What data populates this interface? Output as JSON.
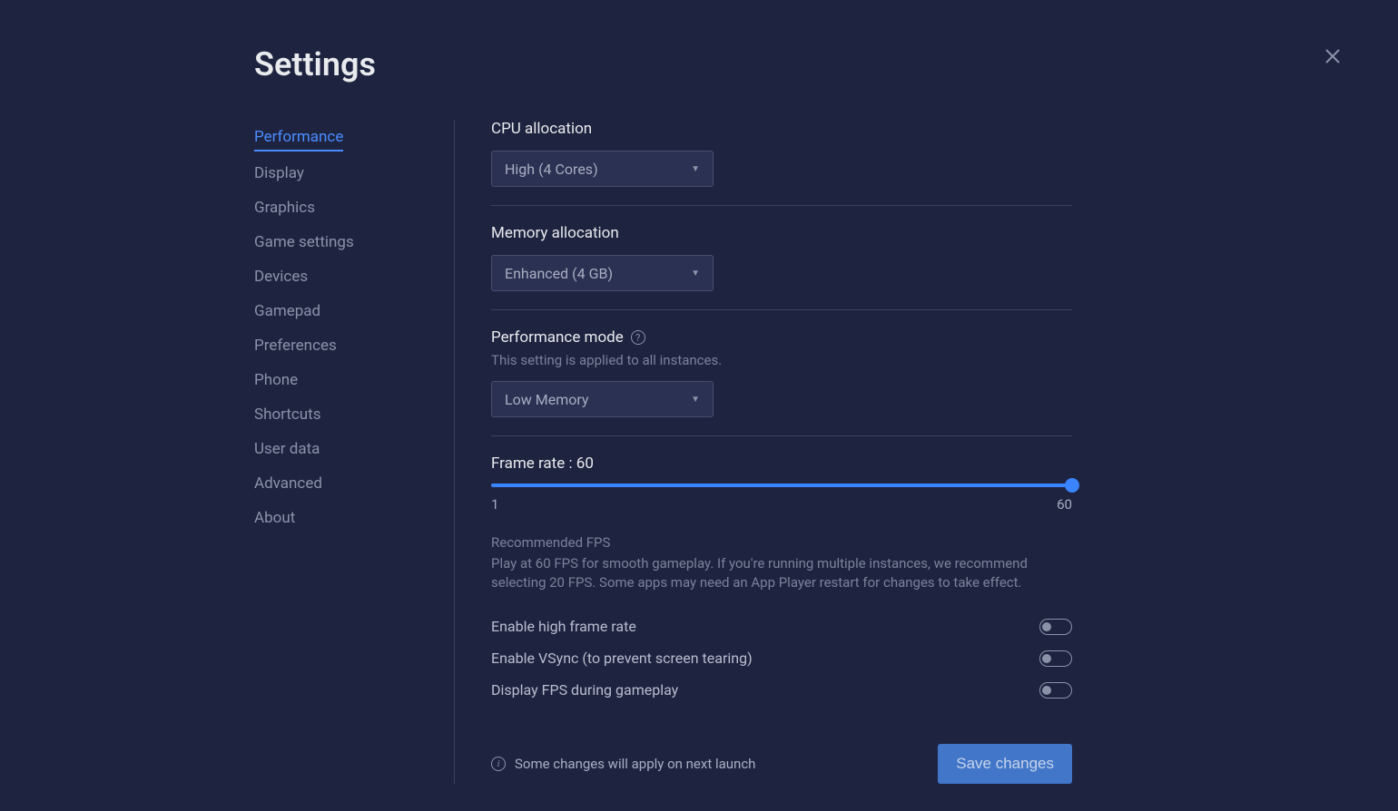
{
  "title": "Settings",
  "sidebar": {
    "items": [
      {
        "label": "Performance",
        "active": true
      },
      {
        "label": "Display",
        "active": false
      },
      {
        "label": "Graphics",
        "active": false
      },
      {
        "label": "Game settings",
        "active": false
      },
      {
        "label": "Devices",
        "active": false
      },
      {
        "label": "Gamepad",
        "active": false
      },
      {
        "label": "Preferences",
        "active": false
      },
      {
        "label": "Phone",
        "active": false
      },
      {
        "label": "Shortcuts",
        "active": false
      },
      {
        "label": "User data",
        "active": false
      },
      {
        "label": "Advanced",
        "active": false
      },
      {
        "label": "About",
        "active": false
      }
    ]
  },
  "sections": {
    "cpu": {
      "label": "CPU allocation",
      "value": "High (4 Cores)"
    },
    "memory": {
      "label": "Memory allocation",
      "value": "Enhanced (4 GB)"
    },
    "performance_mode": {
      "label": "Performance mode",
      "sublabel": "This setting is applied to all instances.",
      "value": "Low Memory"
    },
    "frame_rate": {
      "label": "Frame rate : 60",
      "min": "1",
      "max": "60",
      "current": 60,
      "rec_title": "Recommended FPS",
      "rec_desc": "Play at 60 FPS for smooth gameplay. If you're running multiple instances, we recommend selecting 20 FPS. Some apps may need an App Player restart for changes to take effect."
    },
    "toggles": {
      "high_frame_rate": "Enable high frame rate",
      "vsync": "Enable VSync (to prevent screen tearing)",
      "display_fps": "Display FPS during gameplay"
    }
  },
  "footer": {
    "note": "Some changes will apply on next launch",
    "save_label": "Save changes"
  }
}
